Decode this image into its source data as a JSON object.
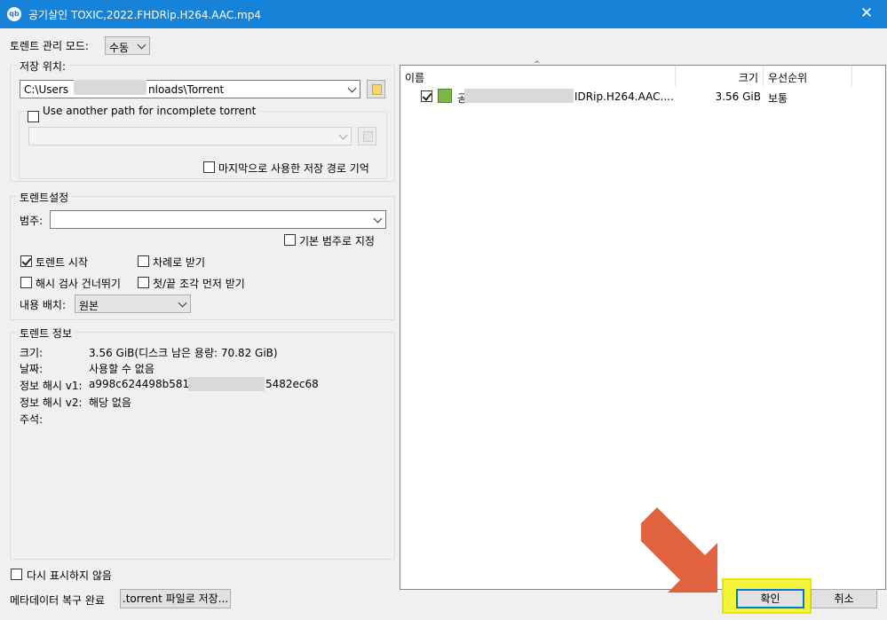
{
  "window": {
    "title": "공기살인 TOXIC,2022.FHDRip.H264.AAC.mp4",
    "app_icon": "qb",
    "close_glyph": "✕"
  },
  "management_mode": {
    "label": "토렌트 관리 모드:",
    "value": "수동"
  },
  "save_location": {
    "group_title": "저장 위치:",
    "path_prefix": "C:\\Users",
    "path_suffix": "nloads\\Torrent",
    "incomplete_label": "Use another path for incomplete torrent",
    "incomplete_checked": false,
    "incomplete_path": "",
    "remember_label": "마지막으로 사용한 저장 경로 기억",
    "remember_checked": false
  },
  "torrent_settings": {
    "group_title": "토렌트설정",
    "category_label": "범주:",
    "category_value": "",
    "default_category_label": "기본 범주로 지정",
    "default_category_checked": false,
    "start_label": "토렌트 시작",
    "start_checked": true,
    "sequential_label": "차례로 받기",
    "sequential_checked": false,
    "skip_hash_label": "해시 검사 건너뛰기",
    "skip_hash_checked": false,
    "first_last_label": "첫/끝 조각 먼저 받기",
    "first_last_checked": false,
    "layout_label": "내용 배치:",
    "layout_value": "원본"
  },
  "torrent_info": {
    "group_title": "토렌트 정보",
    "size_label": "크기:",
    "size_value": "3.56 GiB(디스크 남은 용량: 70.82 GiB)",
    "date_label": "날짜:",
    "date_value": "사용할 수 없음",
    "hash_v1_label": "정보 해시 v1:",
    "hash_v1_prefix": "a998c624498b5819a8",
    "hash_v1_suffix": "5482ec68",
    "hash_v2_label": "정보 해시 v2:",
    "hash_v2_value": "해당 없음",
    "comment_label": "주석:"
  },
  "file_list": {
    "headers": {
      "name": "이름",
      "size": "크기",
      "priority": "우선순위"
    },
    "rows": [
      {
        "checked": true,
        "name_prefix": "공",
        "name_suffix": "IDRip.H264.AAC....",
        "size": "3.56 GiB",
        "priority": "보통"
      }
    ]
  },
  "footer": {
    "dont_show_label": "다시 표시하지 않음",
    "dont_show_checked": false,
    "metadata_label": "메타데이터 복구 완료",
    "save_torrent_label": ".torrent 파일로 저장...",
    "ok_label": "확인",
    "cancel_label": "취소"
  },
  "colors": {
    "titlebar": "#1683d8",
    "highlight": "#f4f43a",
    "arrow": "#e0623f",
    "default_button_border": "#0078d7"
  }
}
